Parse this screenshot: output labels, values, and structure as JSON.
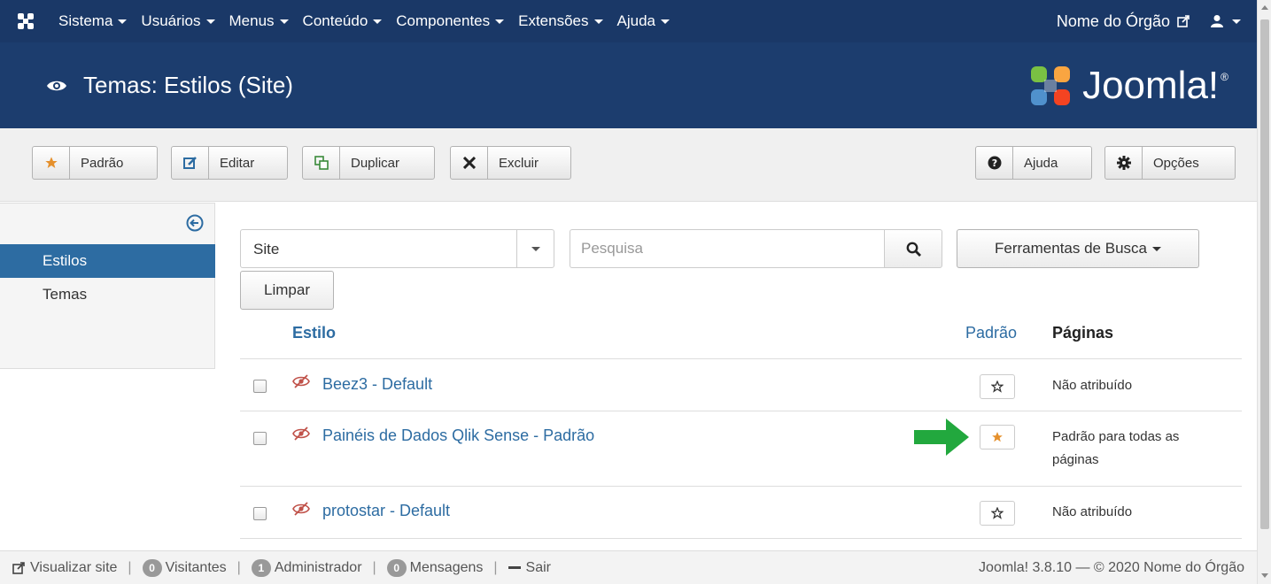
{
  "topnav": {
    "menu": [
      "Sistema",
      "Usuários",
      "Menus",
      "Conteúdo",
      "Componentes",
      "Extensões",
      "Ajuda"
    ],
    "site_name": "Nome do Órgão"
  },
  "header": {
    "title": "Temas: Estilos (Site)",
    "brand": "Joomla!",
    "brand_mark": "®"
  },
  "toolbar": {
    "default_label": "Padrão",
    "edit_label": "Editar",
    "duplicate_label": "Duplicar",
    "delete_label": "Excluir",
    "help_label": "Ajuda",
    "options_label": "Opções"
  },
  "sidebar": {
    "items": [
      {
        "label": "Estilos",
        "active": true
      },
      {
        "label": "Temas",
        "active": false
      }
    ]
  },
  "filters": {
    "client_value": "Site",
    "search_placeholder": "Pesquisa",
    "tools_label": "Ferramentas de Busca",
    "clear_label": "Limpar"
  },
  "table": {
    "headers": {
      "style": "Estilo",
      "default": "Padrão",
      "pages": "Páginas"
    },
    "rows": [
      {
        "name": "Beez3 - Default",
        "is_default": false,
        "pages": "Não atribuído"
      },
      {
        "name": "Painéis de Dados Qlik Sense - Padrão",
        "is_default": true,
        "pages": "Padrão para todas as páginas"
      },
      {
        "name": "protostar - Default",
        "is_default": false,
        "pages": "Não atribuído"
      }
    ]
  },
  "footer": {
    "view_site": "Visualizar site",
    "visitors_count": "0",
    "visitors_label": "Visitantes",
    "admin_count": "1",
    "admin_label": "Administrador",
    "messages_count": "0",
    "messages_label": "Mensagens",
    "logout_label": "Sair",
    "copyright": "Joomla! 3.8.10 — © 2020 Nome do Órgão"
  },
  "colors": {
    "nav_bg": "#1a3867",
    "header_bg": "#1c3d6e",
    "link": "#2d6ca2",
    "star_orange": "#e5902c",
    "arrow_green": "#22a83e"
  }
}
